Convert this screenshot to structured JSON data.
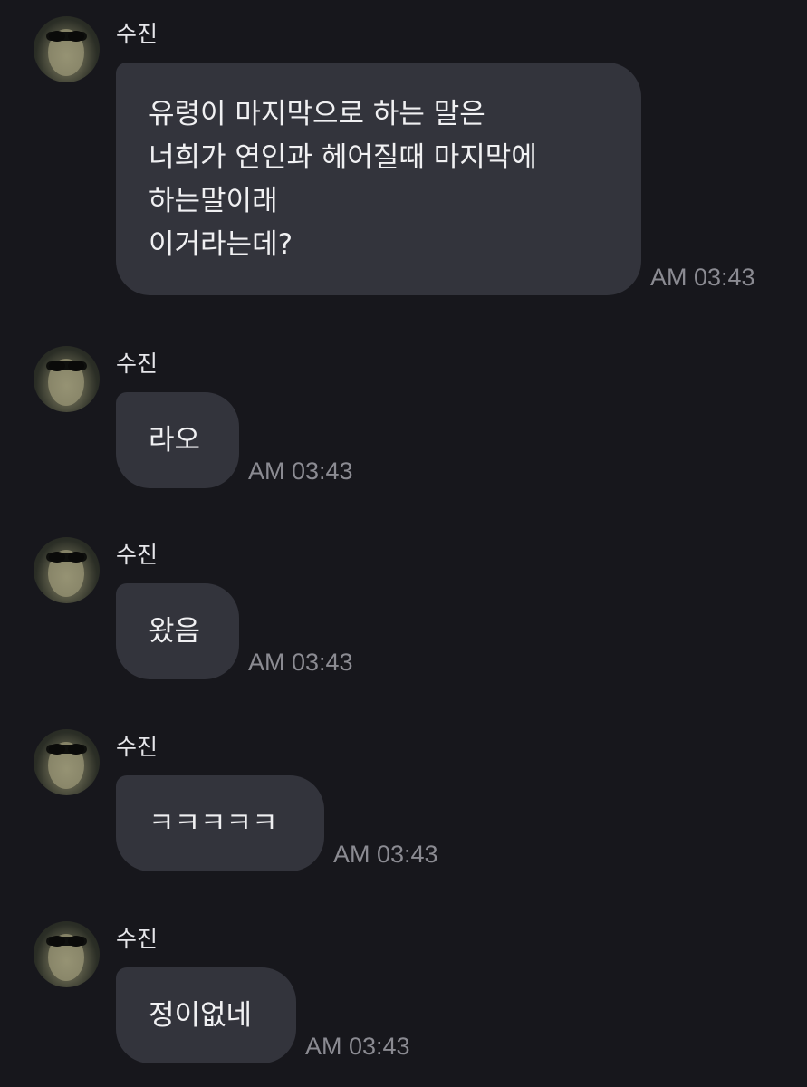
{
  "messages": [
    {
      "sender": "수진",
      "lines": [
        "유령이 마지막으로 하는 말은",
        "너희가 연인과 헤어질때 마지막에",
        "하는말이래",
        "이거라는데?"
      ],
      "time": "AM 03:43"
    },
    {
      "sender": "수진",
      "lines": [
        "라오"
      ],
      "time": "AM 03:43"
    },
    {
      "sender": "수진",
      "lines": [
        "왔음"
      ],
      "time": "AM 03:43"
    },
    {
      "sender": "수진",
      "lines": [
        "ㅋㅋㅋㅋㅋ"
      ],
      "time": "AM 03:43"
    },
    {
      "sender": "수진",
      "lines": [
        "정이없네"
      ],
      "time": "AM 03:43"
    }
  ]
}
